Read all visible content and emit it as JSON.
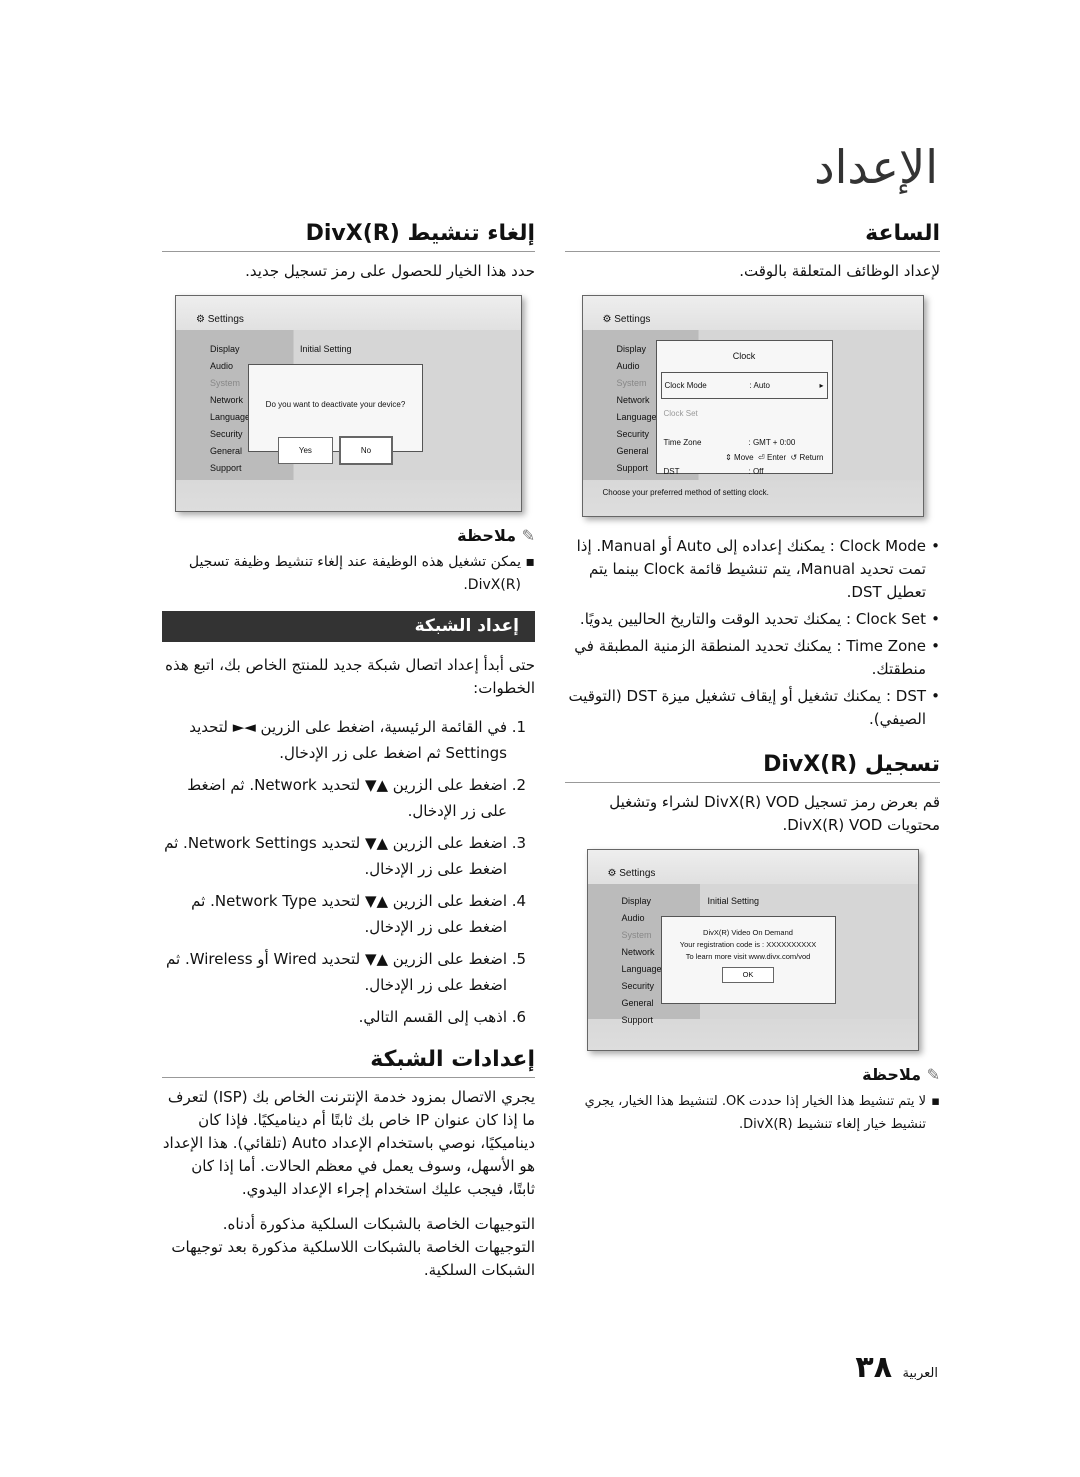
{
  "page_title": "الإعداد",
  "right": {
    "clock": {
      "title": "الساعة",
      "intro": "لإعداد الوظائف المتعلقة بالوقت.",
      "screen": {
        "header": "Settings",
        "menu": [
          "Display",
          "Audio",
          "System",
          "Network",
          "Language",
          "Security",
          "General",
          "Support"
        ],
        "dialog_title": "Clock",
        "rows": [
          [
            "Clock Mode",
            ": Auto"
          ],
          [
            "Clock Set",
            ""
          ],
          [
            "Time Zone",
            ": GMT + 0:00"
          ],
          [
            "DST",
            ": Off"
          ]
        ],
        "nav": [
          "Move",
          "Enter",
          "Return"
        ],
        "footer": "Choose your preferred method of setting clock."
      },
      "bullets": [
        "Clock Mode : يمكنك إعداده إلى Auto أو Manual. إذا تمت تحديد Manual، يتم تنشيط قائمة Clock بينما يتم تعطيل DST.",
        "Clock Set : يمكنك تحديد الوقت والتاريخ الحاليين يدويًا.",
        "Time Zone : يمكنك تحديد المنطقة الزمنية المطبقة في منطقتك.",
        "DST : يمكنك تشغيل أو إيقاف تشغيل ميزة DST (التوقيت الصيفي)."
      ]
    },
    "divx_reg": {
      "title": "تسجيل DivX(R)",
      "intro": "قم بعرض رمز تسجيل DivX(R) VOD لشراء وتشغيل محتويات DivX(R) VOD.",
      "screen": {
        "header": "Settings",
        "menu": [
          "Display",
          "Audio",
          "System",
          "Network",
          "Language",
          "Security",
          "General",
          "Support"
        ],
        "content": "Initial Setting",
        "lines": [
          "DivX(R) Video On Demand",
          "Your registration code is : XXXXXXXXXX",
          "To learn more visit www.divx.com/vod"
        ],
        "ok": "OK"
      },
      "note_label": "ملاحظة",
      "notes": [
        "لا يتم تنشيط هذا الخيار إذا حددت OK. لتنشيط هذا الخيار، يجري تنشيط خيار إلغاء تنشيط DivX(R)."
      ]
    }
  },
  "left": {
    "divx_deact": {
      "title": "إلغاء تنشيط DivX(R)",
      "intro": "حدد هذا الخيار للحصول على رمز تسجيل جديد.",
      "screen": {
        "header": "Settings",
        "menu": [
          "Display",
          "Audio",
          "System",
          "Network",
          "Language",
          "Security",
          "General",
          "Support"
        ],
        "content": "Initial Setting",
        "question": "Do you want to deactivate your device?",
        "yes": "Yes",
        "no": "No"
      },
      "note_label": "ملاحظة",
      "notes": [
        "يمكن تشغيل هذه الوظيفة عند إلغاء تنشيط وظيفة تسجيل DivX(R)."
      ]
    },
    "network_setup": {
      "title": "إعداد الشبكة",
      "intro": "حتى أبدأ إعداد اتصال شبكة جديد للمنتج الخاص بك، اتبع هذه الخطوات:",
      "steps": [
        "في القائمة الرئيسية، اضغط على الزرين ◄► لتحديد Settings ثم اضغط على زر الإدخال.",
        "اضغط على الزرين ▲▼ لتحديد Network. ثم اضغط على زر الإدخال.",
        "اضغط على الزرين ▲▼ لتحديد Network Settings. ثم اضغط على زر الإدخال.",
        "اضغط على الزرين ▲▼ لتحديد Network Type. ثم اضغط على زر الإدخال.",
        "اضغط على الزرين ▲▼ لتحديد Wired أو Wireless. ثم اضغط على زر الإدخال.",
        "اذهب إلى القسم التالي."
      ]
    },
    "network_settings": {
      "title": "إعدادات الشبكة",
      "paragraphs": [
        "يجري الاتصال بمزود خدمة الإنترنت الخاص بك (ISP) لتعرف ما إذا كان عنوان IP خاص بك ثابتًا أم ديناميكيًا. فإذا كان ديناميكيًا، نوصي باستخدام الإعداد Auto (تلقائي). هذا الإعداد هو الأسهل، وسوف يعمل في معظم الحالات. أما إذا كان ثابتًا، فيجب عليك استخدام إجراء الإعداد اليدوي.",
        "التوجيهات الخاصة بالشبكات السلكية مذكورة أدناه. التوجيهات الخاصة بالشبكات اللاسلكية مذكورة بعد توجيهات الشبكات السلكية."
      ]
    }
  },
  "footer": {
    "page_number": "٣٨",
    "language": "العربية"
  }
}
